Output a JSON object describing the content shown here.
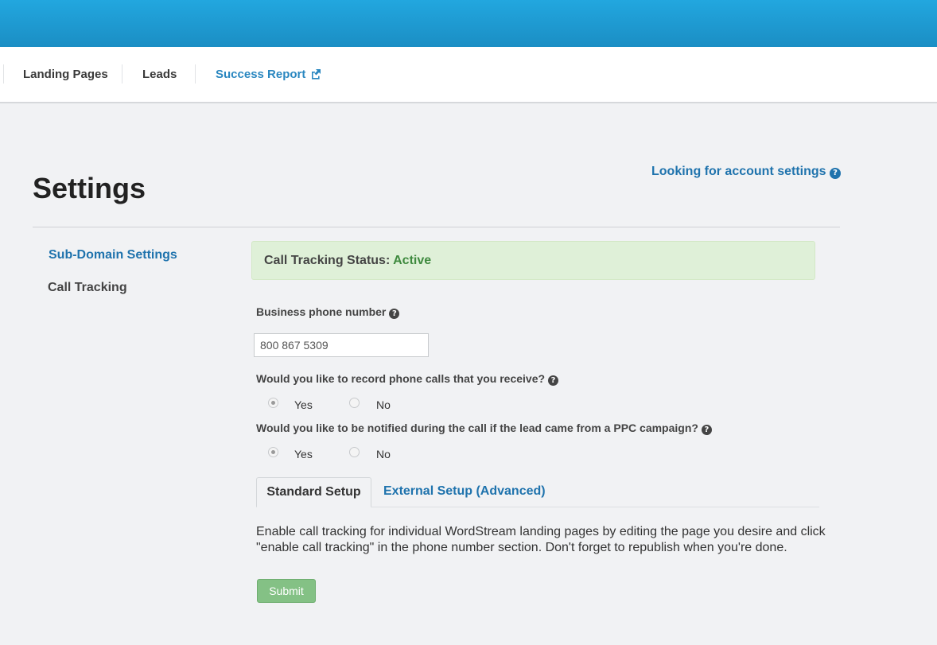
{
  "nav": {
    "items": [
      {
        "label": "Landing Pages"
      },
      {
        "label": "Leads"
      },
      {
        "label": "Success Report"
      }
    ]
  },
  "page": {
    "title": "Settings",
    "account_link": "Looking for account settings"
  },
  "sidebar": {
    "items": [
      {
        "label": "Sub-Domain Settings",
        "active": true
      },
      {
        "label": "Call Tracking",
        "active": false
      }
    ]
  },
  "status": {
    "label": "Call Tracking Status:",
    "value": "Active"
  },
  "form": {
    "phone_label": "Business phone number",
    "phone_value": "800 867 5309",
    "record_question": "Would you like to record phone calls that you receive?",
    "record_options": {
      "yes": "Yes",
      "no": "No",
      "selected": "Yes"
    },
    "notify_question": "Would you like to be notified during the call if the lead came from a PPC campaign?",
    "notify_options": {
      "yes": "Yes",
      "no": "No",
      "selected": "Yes"
    }
  },
  "tabs": [
    {
      "label": "Standard Setup",
      "active": true
    },
    {
      "label": "External Setup (Advanced)",
      "active": false
    }
  ],
  "description": "Enable call tracking for individual WordStream landing pages by editing the page you desire and click \"enable call tracking\" in the phone number section. Don't forget to republish when you're done.",
  "submit_label": "Submit",
  "colors": {
    "header": "#1e9dd6",
    "link": "#1f73ad",
    "success_bg": "#dff0d8",
    "success_text": "#3f8a3f",
    "submit_bg": "#84c185"
  },
  "icons": {
    "external_link": "external-link-icon",
    "help": "question-circle-icon"
  }
}
